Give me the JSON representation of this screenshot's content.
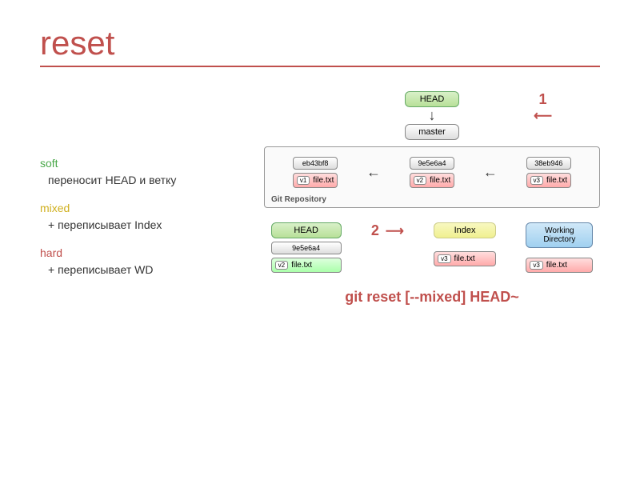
{
  "title": "reset",
  "modes": {
    "soft": {
      "name": "soft",
      "desc": "переносит HEAD и ветку"
    },
    "mixed": {
      "name": "mixed",
      "desc": "+ переписывает Index"
    },
    "hard": {
      "name": "hard",
      "desc": "+ переписывает WD"
    }
  },
  "diagram": {
    "head_label": "HEAD",
    "master_label": "master",
    "step1": "1",
    "step2": "2",
    "repo_label": "Git Repository",
    "commits": [
      {
        "hash": "eb43bf8",
        "v": "v1",
        "file": "file.txt"
      },
      {
        "hash": "9e5e6a4",
        "v": "v2",
        "file": "file.txt"
      },
      {
        "hash": "38eb946",
        "v": "v3",
        "file": "file.txt"
      }
    ],
    "bottom": {
      "head": {
        "title": "HEAD",
        "hash": "9e5e6a4",
        "v": "v2",
        "file": "file.txt"
      },
      "index": {
        "title": "Index",
        "v": "v3",
        "file": "file.txt"
      },
      "wd": {
        "title": "Working\nDirectory",
        "v": "v3",
        "file": "file.txt"
      }
    }
  },
  "command": "git reset [--mixed] HEAD~"
}
